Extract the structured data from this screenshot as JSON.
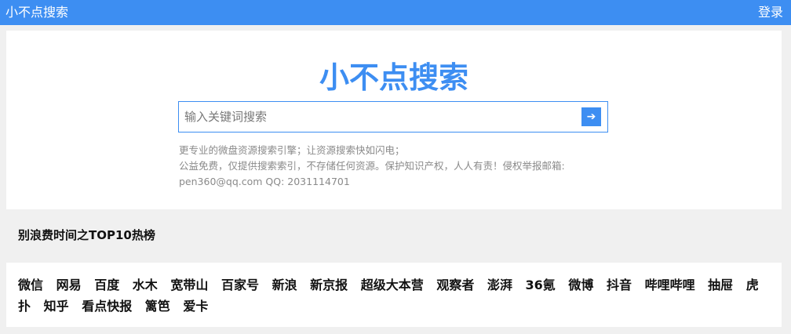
{
  "header": {
    "brand": "小不点搜索",
    "login": "登录"
  },
  "hero": {
    "title": "小不点搜索",
    "search_placeholder": "输入关键词搜索",
    "search_button_icon": "arrow-right-icon",
    "search_button_glyph": "➔",
    "desc_lines": [
      "更专业的微盘资源搜索引擎；让资源搜索快如闪电；",
      "公益免费，仅提供搜索索引，不存储任何资源。保护知识产权，人人有责！侵权举报邮箱:",
      "pen360@qq.com QQ: 2031114701"
    ]
  },
  "top10": {
    "heading": "别浪费时间之TOP10热榜",
    "sites": [
      "微信",
      "网易",
      "百度",
      "水木",
      "宽带山",
      "百家号",
      "新浪",
      "新京报",
      "超级大本营",
      "观察者",
      "澎湃",
      "36氪",
      "微博",
      "抖音",
      "哔哩哔哩",
      "抽屉",
      "虎扑",
      "知乎",
      "看点快报",
      "篱笆",
      "爱卡"
    ]
  },
  "colors": {
    "accent": "#3d8ef2",
    "background": "#f0f0f0"
  }
}
